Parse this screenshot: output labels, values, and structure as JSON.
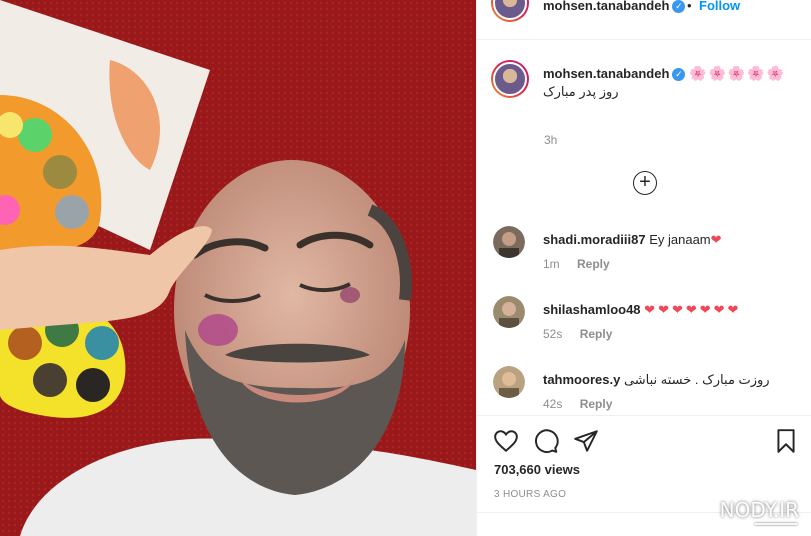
{
  "post": {
    "author": "mohsen.tanabandeh",
    "separator": "•",
    "follow_label": "Follow",
    "caption_emoji": "🌸🌸🌸🌸🌸",
    "caption_text": "روز پدر مبارک",
    "caption_time": "3h",
    "load_more_icon": "plus-circle-icon"
  },
  "comments": [
    {
      "user": "shadi.moradiii87",
      "text": "Ey janaam",
      "suffix": "❤",
      "time": "1m",
      "reply": "Reply"
    },
    {
      "user": "shilashamloo48",
      "text": "",
      "suffix": "❤❤❤❤❤❤❤",
      "time": "52s",
      "reply": "Reply"
    },
    {
      "user": "tahmoores.y",
      "text": "روزت مبارک . خسته نباشی",
      "suffix": "",
      "time": "42s",
      "reply": "Reply"
    }
  ],
  "actions": {
    "views": "703,660 views",
    "ago": "3 HOURS AGO"
  },
  "watermark": {
    "text": "NODY.IR"
  },
  "colors": {
    "link": "#0095f6",
    "heart": "#ed4956",
    "verified": "#3897f0",
    "muted": "#8e8e8e"
  }
}
